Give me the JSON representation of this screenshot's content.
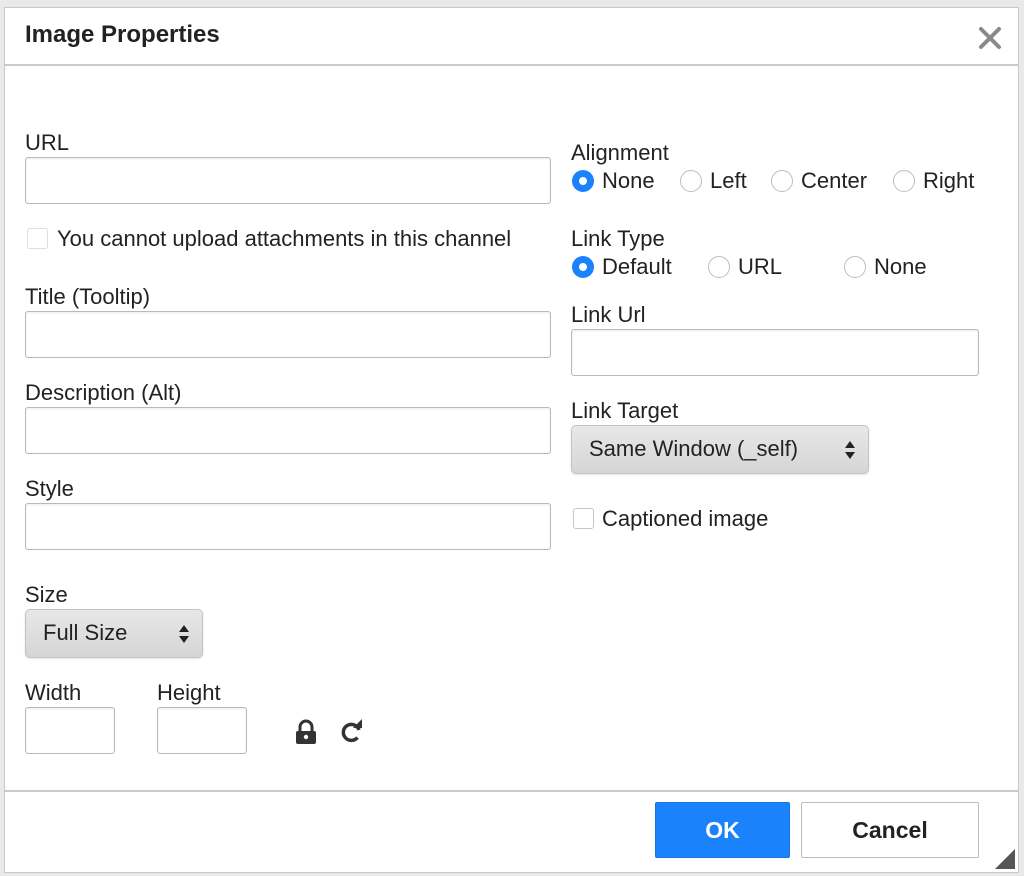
{
  "dialog": {
    "title": "Image Properties",
    "close_icon": "close-icon"
  },
  "left": {
    "url_label": "URL",
    "url_value": "",
    "upload_checkbox_label": "You cannot upload attachments in this channel",
    "upload_checked": false,
    "title_label": "Title (Tooltip)",
    "title_value": "",
    "description_label": "Description (Alt)",
    "description_value": "",
    "style_label": "Style",
    "style_value": "",
    "size_label": "Size",
    "size_selected": "Full Size",
    "width_label": "Width",
    "width_value": "",
    "height_label": "Height",
    "height_value": "",
    "lock_icon": "lock-icon",
    "reset_icon": "refresh-icon"
  },
  "right": {
    "alignment_label": "Alignment",
    "alignment_options": [
      "None",
      "Left",
      "Center",
      "Right"
    ],
    "alignment_selected": "None",
    "link_type_label": "Link Type",
    "link_type_options": [
      "Default",
      "URL",
      "None"
    ],
    "link_type_selected": "Default",
    "link_url_label": "Link Url",
    "link_url_value": "",
    "link_target_label": "Link Target",
    "link_target_selected": "Same Window (_self)",
    "captioned_label": "Captioned image",
    "captioned_checked": false
  },
  "footer": {
    "ok_label": "OK",
    "cancel_label": "Cancel"
  },
  "colors": {
    "accent": "#1a82fb",
    "border": "#c9c9c9"
  }
}
